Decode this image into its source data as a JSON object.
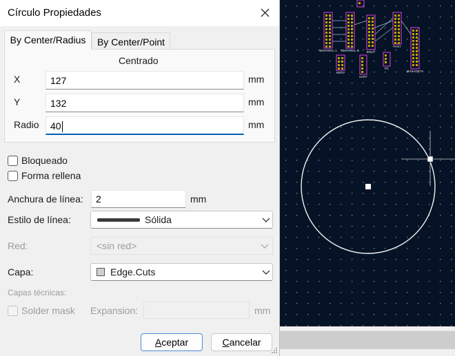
{
  "dialog": {
    "title": "Círculo Propiedades",
    "tabs": [
      {
        "label": "By Center/Radius",
        "active": true
      },
      {
        "label": "By Center/Point",
        "active": false
      }
    ],
    "group_title": "Centrado",
    "x": {
      "label": "X",
      "value": "127",
      "unit": "mm"
    },
    "y": {
      "label": "Y",
      "value": "132",
      "unit": "mm"
    },
    "radius": {
      "label": "Radio",
      "value": "40",
      "unit": "mm"
    },
    "locked": {
      "label": "Bloqueado",
      "checked": false
    },
    "filled": {
      "label": "Forma rellena",
      "checked": false
    },
    "line_width": {
      "label": "Anchura de línea:",
      "value": "2",
      "unit": "mm"
    },
    "line_style": {
      "label": "Estilo de línea:",
      "value": "Sólida"
    },
    "net": {
      "label": "Red:",
      "value": "<sin red>"
    },
    "layer": {
      "label": "Capa:",
      "value": "Edge.Cuts",
      "swatch_color": "#d0d0d0"
    },
    "technical_layers": {
      "label": "Capas técnicas:"
    },
    "solder_mask": {
      "label": "Solder mask",
      "checked": false
    },
    "expansion": {
      "label": "Expansion:",
      "value": "",
      "unit": "mm"
    },
    "ok_label": "Aceptar",
    "ok_underline": "A",
    "ok_rest": "ceptar",
    "cancel_label": "Cancelar",
    "cancel_underline": "C",
    "cancel_rest": "ancelar"
  },
  "pcb_canvas": {
    "background": "#061326",
    "grid_color": "#8a93a6",
    "circle_color": "#f2f2f2",
    "component_labels": [
      "",
      "BIKPARAL 1",
      "BIKPARAL B",
      "BOUT",
      "PAS7",
      "MASAGETA",
      "RECP",
      "UART",
      "PC"
    ]
  },
  "colors": {
    "accent": "#005fb8",
    "pad_fill": "#c9a200",
    "pad_outline": "#e040e0"
  }
}
